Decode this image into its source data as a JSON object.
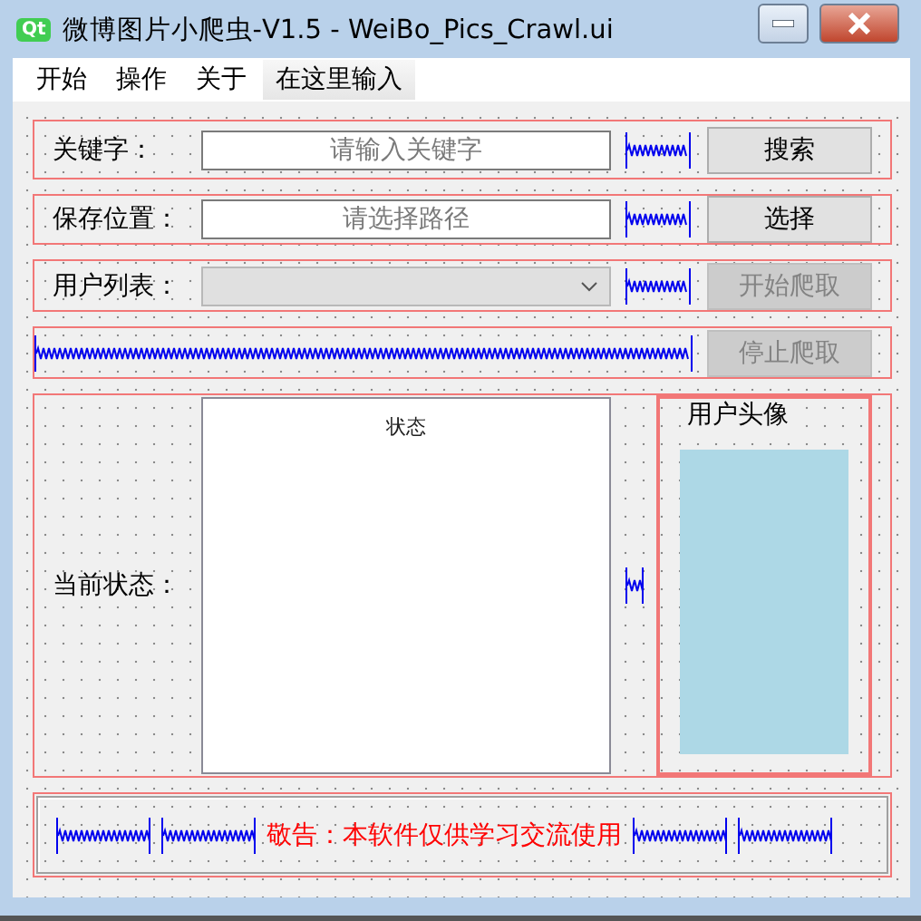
{
  "window": {
    "icon_label": "Qt",
    "title": "微博图片小爬虫-V1.5 - WeiBo_Pics_Crawl.ui"
  },
  "menu": [
    {
      "label": "开始",
      "kind": "menu"
    },
    {
      "label": "操作",
      "kind": "menu"
    },
    {
      "label": "关于",
      "kind": "menu"
    },
    {
      "label": "在这里输入",
      "kind": "entry"
    }
  ],
  "rows": [
    {
      "kind": "input",
      "label": "关键字：",
      "placeholder": "请输入关键字",
      "button": {
        "label": "搜索",
        "disabled": false
      }
    },
    {
      "kind": "input",
      "label": "保存位置：",
      "placeholder": "请选择路径",
      "button": {
        "label": "选择",
        "disabled": false
      }
    },
    {
      "kind": "combo",
      "label": "用户列表：",
      "disabled": true,
      "button": {
        "label": "开始爬取",
        "disabled": true
      }
    },
    {
      "kind": "spacer",
      "button": {
        "label": "停止爬取",
        "disabled": true
      }
    }
  ],
  "status": {
    "label": "当前状态：",
    "header": "状态"
  },
  "avatar": {
    "title": "用户头像"
  },
  "notice": "敬告：本软件仅供学习交流使用"
}
